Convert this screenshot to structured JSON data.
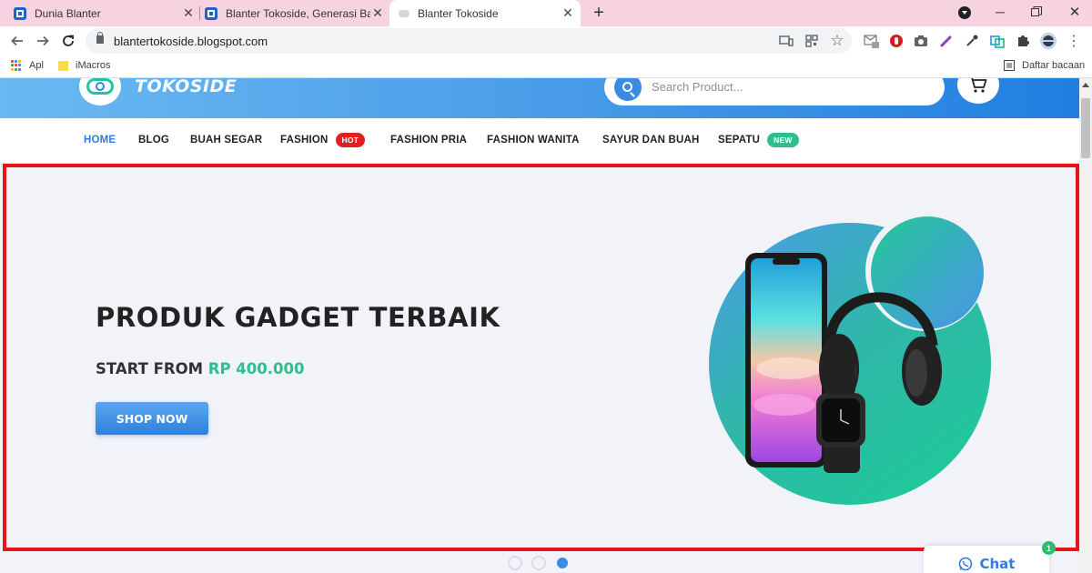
{
  "browser": {
    "tabs": [
      {
        "title": "Dunia Blanter",
        "active": false,
        "favicon": "blanter-icon"
      },
      {
        "title": "Blanter Tokoside, Generasi Baru d",
        "active": false,
        "favicon": "blanter-icon"
      },
      {
        "title": "Blanter Tokoside",
        "active": true,
        "favicon": "cloud-icon"
      }
    ],
    "url": "blantertokoside.blogspot.com",
    "bookmarks": [
      {
        "label": "Apl",
        "icon": "apps-grid-icon"
      },
      {
        "label": "iMacros",
        "icon": "folder-icon"
      }
    ],
    "reading_list_label": "Daftar bacaan"
  },
  "site": {
    "logo_text": "TOKOSIDE",
    "search_placeholder": "Search Product...",
    "nav": [
      {
        "label": "HOME",
        "active": true
      },
      {
        "label": "BLOG"
      },
      {
        "label": "BUAH SEGAR"
      },
      {
        "label": "FASHION",
        "badge": "HOT",
        "badge_color": "#e02020"
      },
      {
        "label": "FASHION PRIA"
      },
      {
        "label": "FASHION WANITA"
      },
      {
        "label": "SAYUR DAN BUAH"
      },
      {
        "label": "SEPATU",
        "badge": "NEW",
        "badge_color": "#2ec08c"
      }
    ]
  },
  "hero": {
    "title": "PRODUK GADGET TERBAIK",
    "subtitle_prefix": "START FROM",
    "price": "RP 400.000",
    "button_label": "SHOP NOW",
    "slides_total": 3,
    "active_slide": 3
  },
  "chat": {
    "label": "Chat",
    "count": "1"
  },
  "colors": {
    "accent_blue": "#2e7de0",
    "price_green": "#2ec08c",
    "highlight_border": "#e8121b"
  }
}
